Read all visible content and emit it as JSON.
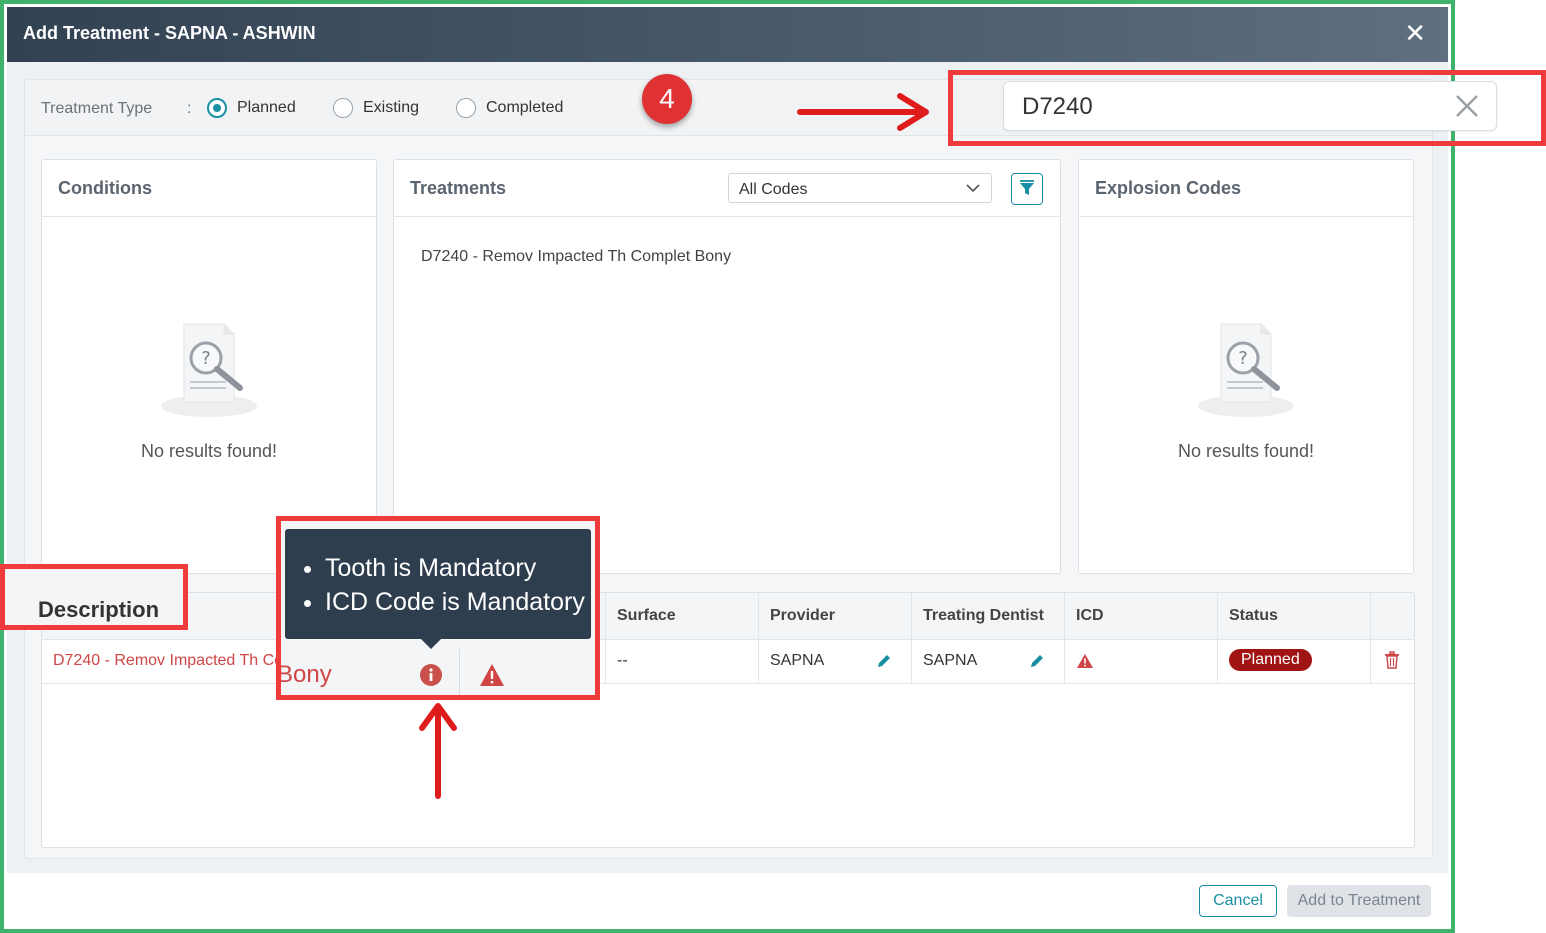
{
  "modal": {
    "title": "Add Treatment - SAPNA - ASHWIN"
  },
  "treatment_type": {
    "label": "Treatment Type",
    "separator": ":",
    "options": [
      {
        "label": "Planned",
        "selected": true
      },
      {
        "label": "Existing",
        "selected": false
      },
      {
        "label": "Completed",
        "selected": false
      }
    ]
  },
  "step": {
    "number": "4"
  },
  "search": {
    "value": "D7240"
  },
  "conditions": {
    "title": "Conditions",
    "empty_text": "No results found!"
  },
  "treatments": {
    "title": "Treatments",
    "filter_value": "All Codes",
    "items": [
      "D7240 - Remov Impacted Th Complet Bony"
    ]
  },
  "explosion": {
    "title": "Explosion Codes",
    "empty_text": "No results found!"
  },
  "table": {
    "headers": {
      "description": "Description",
      "surface": "Surface",
      "provider": "Provider",
      "treating_dentist": "Treating Dentist",
      "icd": "ICD",
      "status": "Status"
    },
    "row": {
      "description": "D7240 - Remov Impacted Th Co",
      "surface": "--",
      "provider": "SAPNA",
      "treating_dentist": "SAPNA",
      "status": "Planned"
    }
  },
  "tooltip": {
    "messages": [
      "Tooth is Mandatory",
      "ICD Code is Mandatory"
    ],
    "zoom_text": "Bony"
  },
  "footer": {
    "cancel": "Cancel",
    "add": "Add to Treatment"
  },
  "colors": {
    "accent": "#1a8fa3",
    "error": "#d04545",
    "status_planned": "#a01414",
    "highlight": "#ef3b3b",
    "frame": "#3fb36b"
  }
}
